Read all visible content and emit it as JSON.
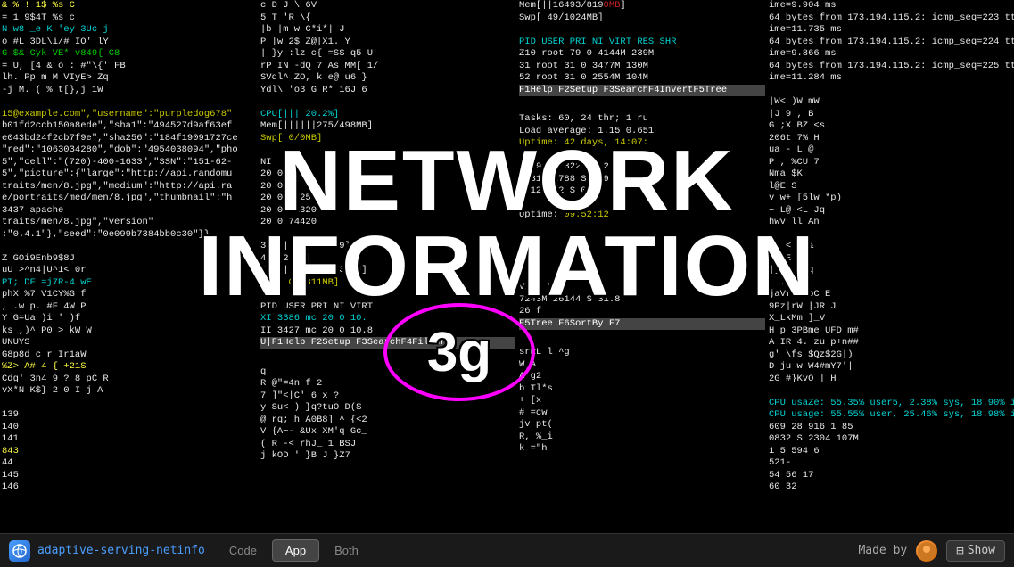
{
  "title": "Network Information",
  "overlay": {
    "line1": "NETWORK",
    "line2": "INFORMATION",
    "badge": "3g"
  },
  "bottomBar": {
    "appIcon": "🌐",
    "appName": "adaptive-serving-netinfo",
    "tabs": [
      {
        "label": "Code",
        "active": false
      },
      {
        "label": "App",
        "active": true
      },
      {
        "label": "Both",
        "active": false
      }
    ],
    "madeBy": "Made by",
    "showLabel": "Show"
  },
  "colors": {
    "accent": "#4a9eff",
    "magentaCircle": "#ff00ff",
    "activeTab": "#444",
    "bottomBar": "#1a1a1a"
  }
}
